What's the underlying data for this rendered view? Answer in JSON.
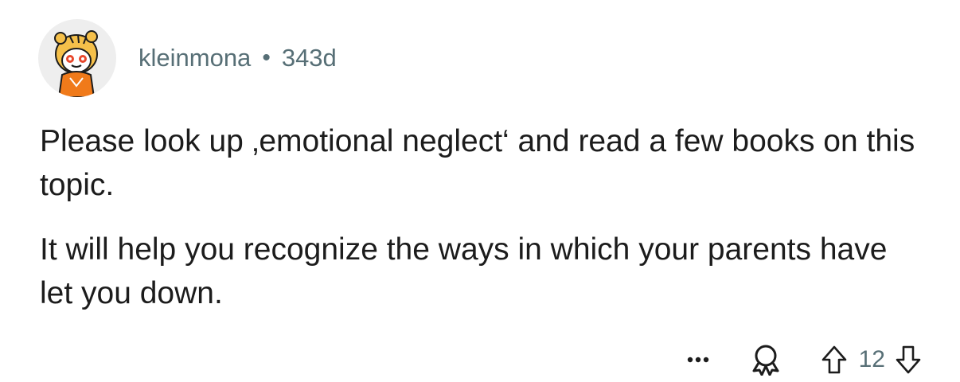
{
  "comment": {
    "author": "kleinmona",
    "separator": "•",
    "age": "343d",
    "paragraphs": [
      "Please look up ‚emotional neglect‘ and read a few books on this topic.",
      "It will help you recognize the ways in which your parents have let you down."
    ],
    "score": "12"
  },
  "icons": {
    "avatar": "snoo-avatar-tiger-costume",
    "more": "more-horizontal-icon",
    "award": "award-icon",
    "upvote": "upvote-arrow-icon",
    "downvote": "downvote-arrow-icon"
  },
  "colors": {
    "meta_text": "#576f76",
    "body_text": "#1c1c1c",
    "avatar_bg": "#eeeeee",
    "avatar_accent": "#f5a623"
  }
}
